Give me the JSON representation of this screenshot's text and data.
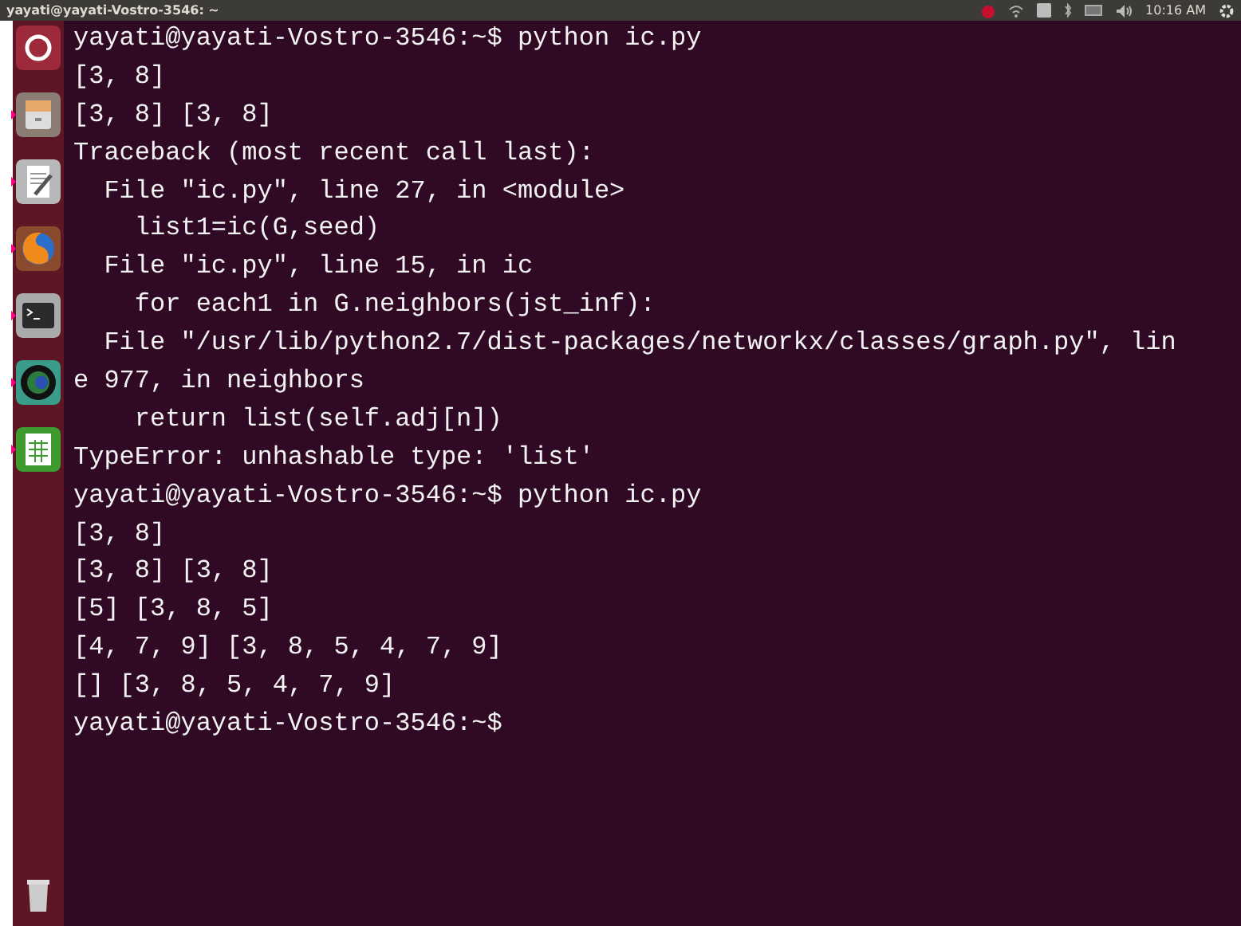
{
  "top_bar": {
    "title": "yayati@yayati-Vostro-3546: ~",
    "clock": "10:16 AM"
  },
  "launcher": {
    "items": [
      {
        "kind": "dash",
        "running": false
      },
      {
        "kind": "files",
        "running": true
      },
      {
        "kind": "editor",
        "running": true
      },
      {
        "kind": "browser",
        "running": true
      },
      {
        "kind": "terminal",
        "running": true
      },
      {
        "kind": "globe",
        "running": true
      },
      {
        "kind": "spreadsheet",
        "running": true
      },
      {
        "kind": "trash",
        "running": false
      }
    ]
  },
  "terminal": {
    "lines": [
      "yayati@yayati-Vostro-3546:~$ python ic.py",
      "[3, 8]",
      "[3, 8] [3, 8]",
      "Traceback (most recent call last):",
      "  File \"ic.py\", line 27, in <module>",
      "    list1=ic(G,seed)",
      "  File \"ic.py\", line 15, in ic",
      "    for each1 in G.neighbors(jst_inf):",
      "  File \"/usr/lib/python2.7/dist-packages/networkx/classes/graph.py\", lin",
      "e 977, in neighbors",
      "    return list(self.adj[n])",
      "TypeError: unhashable type: 'list'",
      "yayati@yayati-Vostro-3546:~$ python ic.py",
      "[3, 8]",
      "[3, 8] [3, 8]",
      "[5] [3, 8, 5]",
      "[4, 7, 9] [3, 8, 5, 4, 7, 9]",
      "[] [3, 8, 5, 4, 7, 9]",
      "yayati@yayati-Vostro-3546:~$"
    ]
  }
}
